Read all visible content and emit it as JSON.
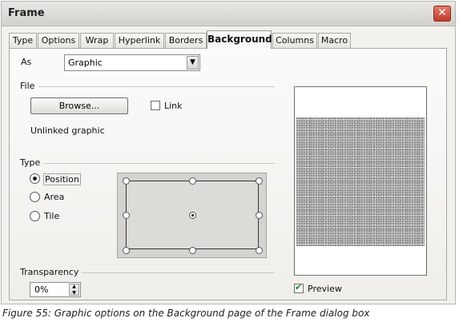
{
  "window": {
    "title": "Frame"
  },
  "tabs": [
    {
      "label": "Type"
    },
    {
      "label": "Options"
    },
    {
      "label": "Wrap"
    },
    {
      "label": "Hyperlink"
    },
    {
      "label": "Borders"
    },
    {
      "label": "Background",
      "active": true
    },
    {
      "label": "Columns"
    },
    {
      "label": "Macro"
    }
  ],
  "as_field": {
    "label": "As",
    "value": "Graphic"
  },
  "file": {
    "section_label": "File",
    "browse_label": "Browse...",
    "link_label": "Link",
    "link_checked": false,
    "status": "Unlinked graphic"
  },
  "type": {
    "section_label": "Type",
    "options": [
      {
        "label": "Position",
        "selected": true
      },
      {
        "label": "Area",
        "selected": false
      },
      {
        "label": "Tile",
        "selected": false
      }
    ]
  },
  "transparency": {
    "label": "Transparency",
    "value": "0%"
  },
  "preview": {
    "label": "Preview",
    "checked": true
  },
  "caption": "Figure 55: Graphic options on the Background page of the Frame dialog box",
  "colors": {
    "close_button": "#c13b2b",
    "dialog_bg": "#f2f1ed"
  }
}
